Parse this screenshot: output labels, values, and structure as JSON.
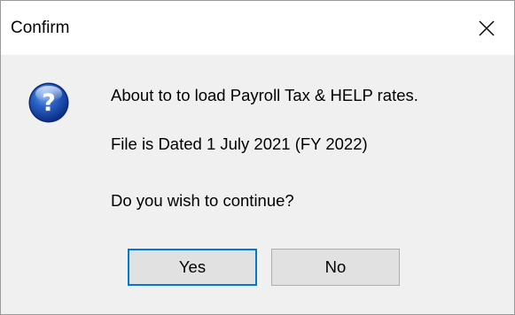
{
  "window": {
    "title": "Confirm",
    "close_label": "Close"
  },
  "message": {
    "icon": "question-icon",
    "line1": "About to to load Payroll Tax & HELP rates.",
    "line2": "File is Dated 1 July 2021 (FY 2022)",
    "line3": "Do you wish to continue?"
  },
  "buttons": {
    "yes_label": "Yes",
    "no_label": "No",
    "default": "Yes"
  },
  "colors": {
    "focus_border": "#0078d7",
    "icon_blue": "#1f56b8"
  }
}
